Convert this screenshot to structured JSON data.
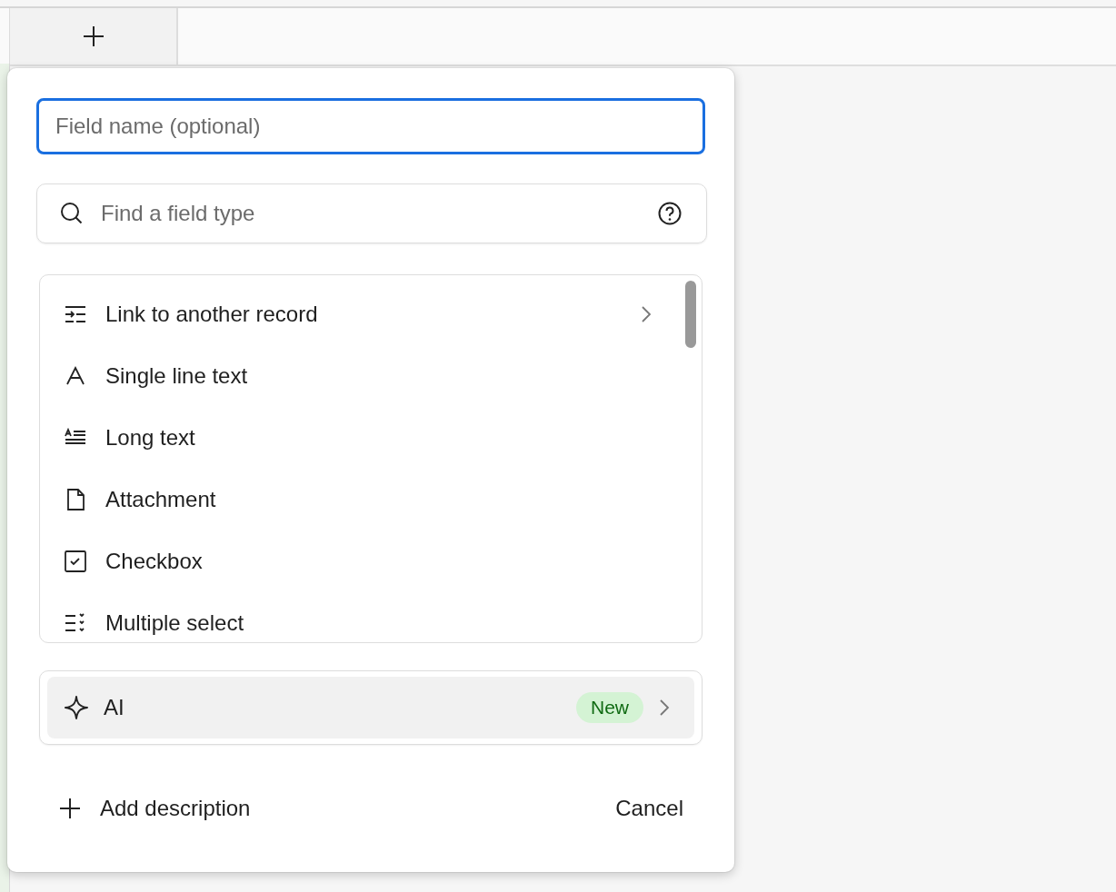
{
  "field_name": {
    "placeholder": "Field name (optional)"
  },
  "search": {
    "placeholder": "Find a field type"
  },
  "field_types": [
    {
      "kind": "link",
      "label": "Link to another record",
      "has_submenu": true
    },
    {
      "kind": "single-line",
      "label": "Single line text",
      "has_submenu": false
    },
    {
      "kind": "long-text",
      "label": "Long text",
      "has_submenu": false
    },
    {
      "kind": "attachment",
      "label": "Attachment",
      "has_submenu": false
    },
    {
      "kind": "checkbox",
      "label": "Checkbox",
      "has_submenu": false
    },
    {
      "kind": "multi-select",
      "label": "Multiple select",
      "has_submenu": false
    }
  ],
  "ai_option": {
    "label": "AI",
    "badge": "New"
  },
  "footer": {
    "add_description": "Add description",
    "cancel": "Cancel"
  }
}
